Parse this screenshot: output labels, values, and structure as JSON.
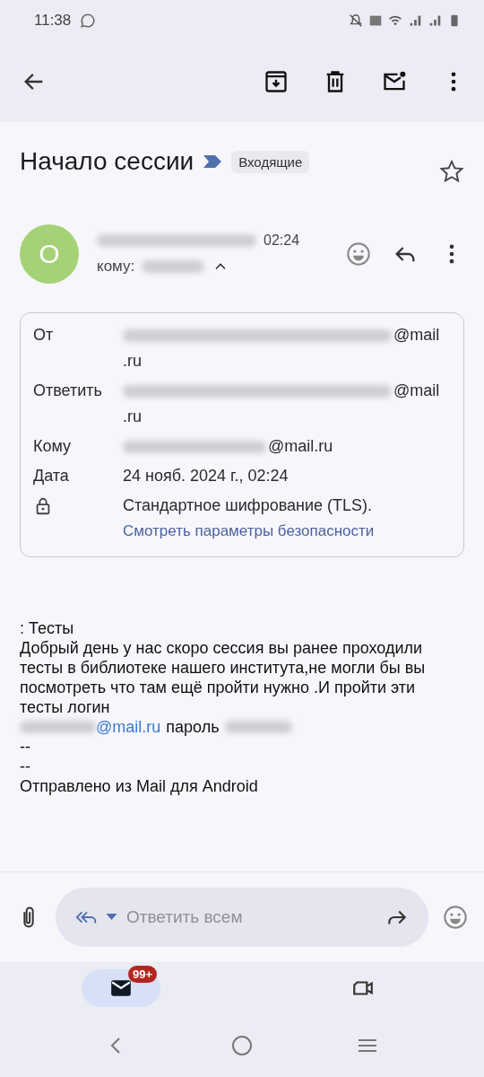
{
  "status_bar": {
    "time": "11:38"
  },
  "subject": {
    "title": "Начало сессии",
    "important": true,
    "label": "Входящие",
    "starred": false
  },
  "sender": {
    "avatar_letter": "О",
    "time": "02:24",
    "to_label": "кому:",
    "expanded": true
  },
  "details": [
    {
      "kind": "address",
      "label": "От",
      "value_lines": [
        "@mail",
        ".ru"
      ]
    },
    {
      "kind": "address",
      "label": "Ответить",
      "value_lines": [
        "@mail",
        ".ru"
      ]
    },
    {
      "kind": "address",
      "label": "Кому",
      "value_lines": [
        "@mail.ru"
      ]
    },
    {
      "kind": "plain",
      "label": "Дата",
      "value_lines": [
        "24 нояб. 2024 г., 02:24"
      ]
    },
    {
      "kind": "security",
      "value_lines": [
        "Стандартное шифрование (TLS)."
      ],
      "link": "Смотреть параметры безопасности"
    }
  ],
  "body": {
    "subject_line": ": Тесты",
    "paragraph": "Добрый день у нас скоро сессия вы ранее проходили тесты в библиотеке нашего института,не могли бы вы посмотреть что там ещё пройти нужно .И пройти эти тесты логин",
    "login_link": "@mail.ru",
    "password_label": "пароль",
    "signature": [
      "--",
      "--",
      "Отправлено из Mail для Android"
    ]
  },
  "reply_bar": {
    "placeholder": "Ответить всем"
  },
  "bottom_nav": [
    {
      "kind": "mail",
      "selected": true,
      "badge": "99+"
    },
    {
      "kind": "meet",
      "selected": false
    }
  ]
}
